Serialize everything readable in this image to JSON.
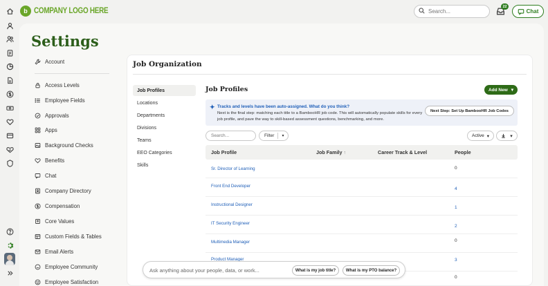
{
  "header": {
    "logo_mark": "b",
    "logo_text": "COMPANY LOGO HERE",
    "search_placeholder": "Search...",
    "notification_count": "22",
    "chat_label": "Chat"
  },
  "rail": {
    "icons": [
      "home-icon",
      "person-icon",
      "people-icon",
      "clipboard-icon",
      "pie-chart-icon",
      "document-icon",
      "dollar-icon",
      "money-icon",
      "heart-icon",
      "card-icon",
      "handshake-icon",
      "badge-icon",
      "globe-icon"
    ],
    "bottom_icons": [
      "help-icon",
      "gear-icon",
      "expand-icon"
    ],
    "active": "gear-icon"
  },
  "page_title": "Settings",
  "settings_nav": [
    {
      "label": "Account",
      "icon": "wrench-icon"
    },
    {
      "label": "Access Levels",
      "icon": "lock-icon"
    },
    {
      "label": "Employee Fields",
      "icon": "list-icon"
    },
    {
      "label": "Approvals",
      "icon": "check-circle-icon"
    },
    {
      "label": "Apps",
      "icon": "apps-icon"
    },
    {
      "label": "Background Checks",
      "icon": "image-icon"
    },
    {
      "label": "Benefits",
      "icon": "benefits-icon"
    },
    {
      "label": "Chat",
      "icon": "chat-icon"
    },
    {
      "label": "Company Directory",
      "icon": "directory-icon"
    },
    {
      "label": "Compensation",
      "icon": "compensation-icon"
    },
    {
      "label": "Core Values",
      "icon": "core-values-icon"
    },
    {
      "label": "Custom Fields & Tables",
      "icon": "custom-fields-icon"
    },
    {
      "label": "Email Alerts",
      "icon": "email-icon"
    },
    {
      "label": "Employee Community",
      "icon": "community-icon"
    },
    {
      "label": "Employee Satisfaction",
      "icon": "smile-icon"
    }
  ],
  "card": {
    "title": "Job Organization",
    "subnav": [
      "Job Profiles",
      "Locations",
      "Departments",
      "Divisions",
      "Teams",
      "EEO Categories",
      "Skills"
    ],
    "active_subnav": "Job Profiles"
  },
  "job_profiles": {
    "title": "Job Profiles",
    "add_new_label": "Add New",
    "info_title": "Tracks and levels have been auto-assigned. What do you think?",
    "info_body": "Next is the final step: matching each title to a BambooHR job code. This will automatically populate skills for every job profile, and pave the way to skill-based assessment questions, benchmarking, and more.",
    "next_step_label": "Next Step: Set Up BambooHR Job Codes",
    "search_placeholder": "Search...",
    "filter_label": "Filter",
    "status_label": "Active",
    "columns": {
      "job_profile": "Job Profile",
      "job_family": "Job Family",
      "career_track": "Career Track & Level",
      "people": "People"
    },
    "rows": [
      {
        "name": "Sr. Director of Learning",
        "people": "0"
      },
      {
        "name": "Front End Developer",
        "people": "4"
      },
      {
        "name": "Instructional Designer",
        "people": "1"
      },
      {
        "name": "IT Security Engineer",
        "people": "2"
      },
      {
        "name": "Multimedia Manager",
        "people": "0"
      },
      {
        "name": "Product Manager",
        "people": "3"
      },
      {
        "name": "",
        "people": "0"
      }
    ]
  },
  "ask": {
    "placeholder": "Ask anything about your people, data, or work...",
    "chip1": "What is my job title?",
    "chip2": "What is my PTO balance?"
  },
  "colors": {
    "brand_green": "#2e6b17",
    "logo_green": "#6aa629",
    "link_blue": "#1f5fb8"
  }
}
